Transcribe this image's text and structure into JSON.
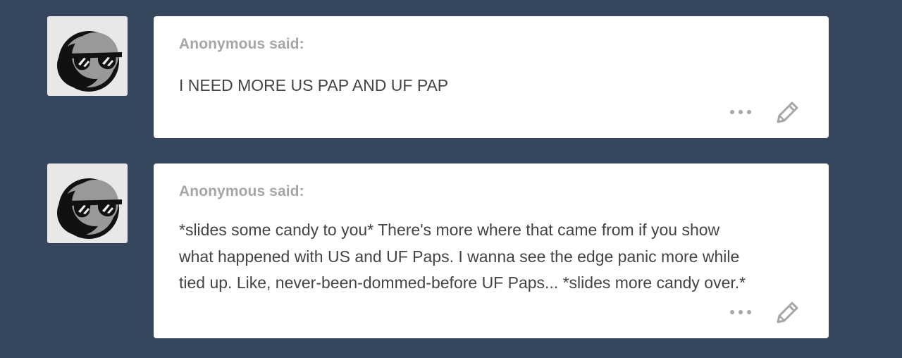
{
  "colors": {
    "background": "#36465d",
    "card": "#ffffff",
    "asker_text": "#a6a6a6",
    "body_text": "#444444",
    "icon": "#a6a6a6"
  },
  "asks": [
    {
      "avatar_icon": "sunglasses-moon-avatar-icon",
      "asker": "Anonymous said:",
      "lines": [
        "I NEED MORE US PAP AND UF PAP"
      ],
      "more_icon": "ellipsis-icon",
      "edit_icon": "pencil-icon"
    },
    {
      "avatar_icon": "sunglasses-moon-avatar-icon",
      "asker": "Anonymous said:",
      "lines": [
        "*slides some candy to you* There's more where that came from if you show",
        "what happened with US and UF Paps. I wanna see the edge panic more while",
        "tied up. Like, never-been-dommed-before UF Paps... *slides more candy over.*"
      ],
      "more_icon": "ellipsis-icon",
      "edit_icon": "pencil-icon"
    }
  ]
}
